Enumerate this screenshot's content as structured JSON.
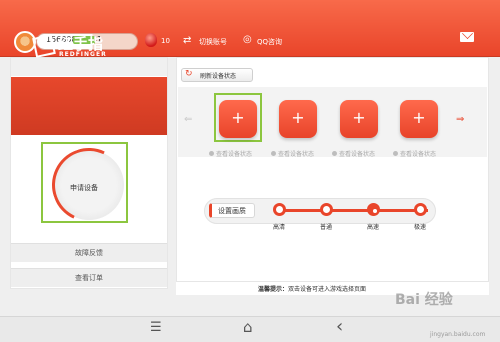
{
  "header": {
    "phone_number": "15680805661",
    "ruby_count": "10",
    "switch_account_label": "切换账号",
    "qq_consult_label": "QQ咨询",
    "icons": {
      "ruby": "ruby-icon",
      "switch": "switch-account-icon",
      "qq": "qq-icon",
      "mail": "mail-icon"
    }
  },
  "left_panel": {
    "brand_name": "红手指",
    "brand_sub": "REDFINGER",
    "apply_device_label": "申请设备",
    "feedback_label": "故障反馈",
    "order_label": "查看订单"
  },
  "right_panel": {
    "refresh_label": "刷新设备状态",
    "devices": [
      {
        "plus": "+",
        "status": "查看设备状态"
      },
      {
        "plus": "+",
        "status": "查看设备状态"
      },
      {
        "plus": "+",
        "status": "查看设备状态"
      },
      {
        "plus": "+",
        "status": "查看设备状态"
      }
    ],
    "prev_arrow": "⇐",
    "next_arrow": "⇒",
    "quality_setting_label": "设置画质",
    "quality_options": [
      "高清",
      "普通",
      "高速",
      "极速"
    ],
    "selected_quality": "高速",
    "tip_prefix": "温馨提示：",
    "tip_text": "双击设备可进入游戏选择页面"
  },
  "bottom_nav": {
    "menu_icon": "☰",
    "home_icon": "⌂",
    "back_icon": "‹"
  },
  "watermark": {
    "text": "Bai 经验",
    "url": "jingyan.baidu.com"
  },
  "colors": {
    "accent": "#e9452a",
    "highlight": "#8cc63f"
  }
}
